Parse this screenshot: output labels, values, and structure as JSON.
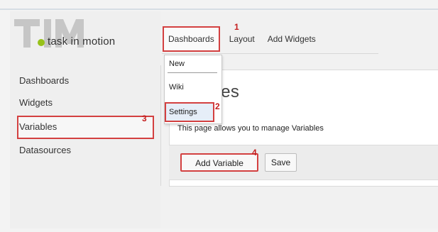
{
  "logo": {
    "brand": "TIM",
    "tagline": "task in motion",
    "colors": {
      "mark": "#c6c6c6",
      "dot": "#97c21a"
    }
  },
  "topnav": {
    "items": [
      {
        "label": "Dashboards",
        "marker": "1"
      },
      {
        "label": "Layout"
      },
      {
        "label": "Add Widgets"
      }
    ]
  },
  "dropdown": {
    "items": [
      {
        "label": "New"
      },
      {
        "label": "Wiki"
      },
      {
        "label": "Settings",
        "marker": "2"
      }
    ]
  },
  "sidebar": {
    "items": [
      {
        "label": "Dashboards"
      },
      {
        "label": "Widgets"
      },
      {
        "label": "Variables",
        "marker": "3"
      },
      {
        "label": "Datasources"
      }
    ]
  },
  "main": {
    "title": "Variables",
    "title_visible_suffix": "bles",
    "description": "This page allows you to manage Variables",
    "buttons": {
      "add_label": "Add Variable",
      "add_marker": "4",
      "save_label": "Save"
    }
  },
  "colors": {
    "highlight": "#d34040",
    "marker": "#c41e1e"
  }
}
